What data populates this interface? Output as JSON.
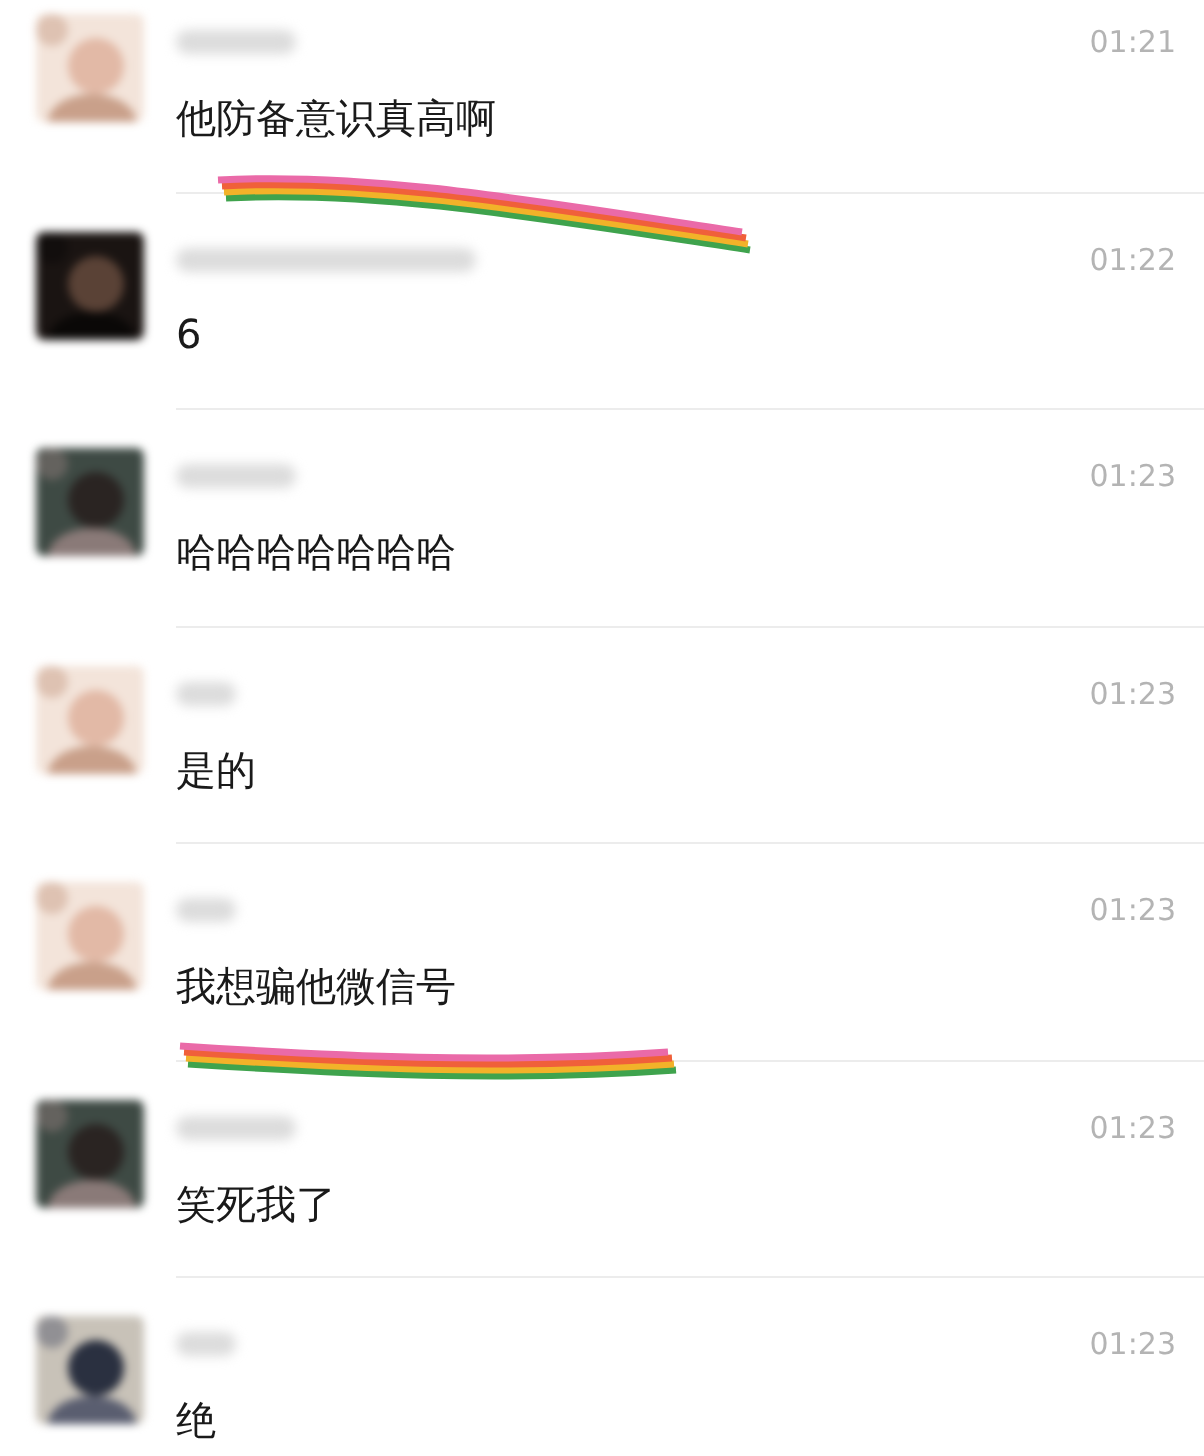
{
  "messages": [
    {
      "time": "01:21",
      "text": "他防备意识真高啊",
      "highlighted": true
    },
    {
      "time": "01:22",
      "text": "6",
      "highlighted": false
    },
    {
      "time": "01:23",
      "text": "哈哈哈哈哈哈哈",
      "highlighted": false
    },
    {
      "time": "01:23",
      "text": "是的",
      "highlighted": false
    },
    {
      "time": "01:23",
      "text": "我想骗他微信号",
      "highlighted": true
    },
    {
      "time": "01:23",
      "text": "笑死我了",
      "highlighted": false
    },
    {
      "time": "01:23",
      "text": "绝",
      "highlighted": false
    }
  ]
}
